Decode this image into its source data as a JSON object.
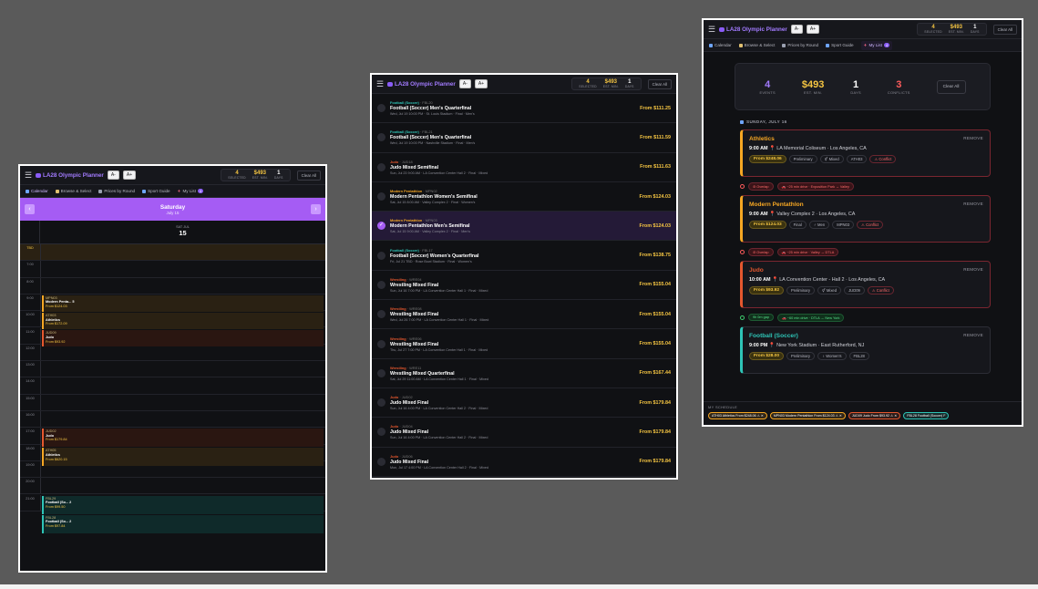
{
  "app": {
    "title": "LA28 Olympic Planner",
    "font_small": "A-",
    "font_large": "A+",
    "stats": {
      "selected_value": "4",
      "selected_label": "SELECTED",
      "min_value": "$493",
      "min_label": "EST. MIN.",
      "days_value": "1",
      "days_label": "DAYS"
    },
    "clear_label": "Clear All",
    "tabs": [
      "Calendar",
      "Browse & Select",
      "Prices by Round",
      "Sport Guide",
      "My List"
    ],
    "my_list_count": "4"
  },
  "calendar": {
    "day_name": "Saturday",
    "day_sub": "July 15",
    "col_dayname": "SAT JUL",
    "col_daynum": "15",
    "hours": [
      "TBD",
      "7:00",
      "8:00",
      "9:00",
      "10:00",
      "11:00",
      "12:00",
      "13:00",
      "14:00",
      "15:00",
      "16:00",
      "17:00",
      "18:00",
      "19:00",
      "20:00",
      "21:00"
    ],
    "events": [
      {
        "code": "MPN03",
        "name": "Modern Penta... 5",
        "price": "From $124.03",
        "color": "#f5a623"
      },
      {
        "code": "ATH03",
        "name": "Athletics",
        "price": "From $172.09",
        "color": "#f5a623"
      },
      {
        "code": "JUD09",
        "name": "Judo",
        "price": "From $93.92",
        "color": "#e4572e"
      },
      {
        "code": "JUD02",
        "name": "Judo",
        "price": "From $179.84",
        "color": "#e4572e"
      },
      {
        "code": "ATH05",
        "name": "Athletics",
        "price": "From $620.15",
        "color": "#f5a623"
      },
      {
        "code": "FBL29",
        "name": "Football (So... 2",
        "price": "From $99.50",
        "color": "#2ec4b6"
      },
      {
        "code": "FBL28",
        "name": "Football (So... 2",
        "price": "From $97.84",
        "color": "#2ec4b6"
      }
    ]
  },
  "browse": {
    "rows": [
      {
        "cat": "Football (Soccer)",
        "code": "FBL20",
        "title": "Football (Soccer) Men's Quarterfinal",
        "meta": "Wed, Jul 19 10:00 PM · St. Louis Stadium · Final · Men's",
        "price": "From $111.25",
        "color": "#2ec4b6",
        "selected": false
      },
      {
        "cat": "Football (Soccer)",
        "code": "FBL21",
        "title": "Football (Soccer) Men's Quarterfinal",
        "meta": "Wed, Jul 19 10:00 PM · Nashville Stadium · Final · Men's",
        "price": "From $111.59",
        "color": "#2ec4b6",
        "selected": false
      },
      {
        "cat": "Judo",
        "code": "JUD18",
        "title": "Judo Mixed Semifinal",
        "meta": "Sun, Jul 23 9:00 AM · LA Convention Center Hall 2 · Final · Mixed",
        "price": "From $111.63",
        "color": "#e4572e",
        "selected": false
      },
      {
        "cat": "Modern Pentathlon",
        "code": "MPN02",
        "title": "Modern Pentathlon Women's Semifinal",
        "meta": "Sat, Jul 15 8:00 AM · Valley Complex 2 · Final · Women's",
        "price": "From $124.03",
        "color": "#f5a623",
        "selected": false
      },
      {
        "cat": "Modern Pentathlon",
        "code": "MPN03",
        "title": "Modern Pentathlon Men's Semifinal",
        "meta": "Sat, Jul 15 9:00 AM · Valley Complex 2 · Final · Men's",
        "price": "From $124.03",
        "color": "#f5a623",
        "selected": true
      },
      {
        "cat": "Football (Soccer)",
        "code": "FBL17",
        "title": "Football (Soccer) Women's Quarterfinal",
        "meta": "Fri, Jul 21 TBD · Rose Bowl Stadium · Final · Women's",
        "price": "From $138.75",
        "color": "#2ec4b6",
        "selected": false,
        "tbd": true
      },
      {
        "cat": "Wrestling",
        "code": "WRE04",
        "title": "Wrestling Mixed Final",
        "meta": "Sun, Jul 16 7:00 PM · LA Convention Center Hall 1 · Final · Mixed",
        "price": "From $155.04",
        "color": "#e4572e",
        "selected": false
      },
      {
        "cat": "Wrestling",
        "code": "WRE08",
        "title": "Wrestling Mixed Final",
        "meta": "Wed, Jul 26 7:00 PM · LA Convention Center Hall 1 · Final · Mixed",
        "price": "From $155.04",
        "color": "#e4572e",
        "selected": false
      },
      {
        "cat": "Wrestling",
        "code": "WRE06",
        "title": "Wrestling Mixed Final",
        "meta": "Thu, Jul 27 7:00 PM · LA Convention Center Hall 1 · Final · Mixed",
        "price": "From $155.04",
        "color": "#e4572e",
        "selected": false
      },
      {
        "cat": "Wrestling",
        "code": "WRE11",
        "title": "Wrestling Mixed Quarterfinal",
        "meta": "Sat, Jul 29 11:00 AM · LA Convention Center Hall 1 · Final · Mixed",
        "price": "From $167.44",
        "color": "#e4572e",
        "selected": false
      },
      {
        "cat": "Judo",
        "code": "JUD02",
        "title": "Judo Mixed Final",
        "meta": "Sun, Jul 16 4:00 PM · LA Convention Center Hall 2 · Final · Mixed",
        "price": "From $179.84",
        "color": "#e4572e",
        "selected": false
      },
      {
        "cat": "Judo",
        "code": "JUD04",
        "title": "Judo Mixed Final",
        "meta": "Sun, Jul 16 4:00 PM · LA Convention Center Hall 2 · Final · Mixed",
        "price": "From $179.84",
        "color": "#e4572e",
        "selected": false
      },
      {
        "cat": "Judo",
        "code": "JUD06",
        "title": "Judo Mixed Final",
        "meta": "Mon, Jul 17 4:00 PM · LA Convention Center Hall 2 · Final · Mixed",
        "price": "From $179.84",
        "color": "#e4572e",
        "selected": false
      }
    ]
  },
  "mylist": {
    "summary": [
      {
        "value": "4",
        "label": "EVENTS",
        "color": "#a27bff"
      },
      {
        "value": "$493",
        "label": "EST. MIN.",
        "color": "#f5c542"
      },
      {
        "value": "1",
        "label": "DAYS",
        "color": "#ffffff"
      },
      {
        "value": "3",
        "label": "CONFLICTS",
        "color": "#ff5c5c"
      }
    ],
    "clear_label": "Clear All",
    "day_header": "SUNDAY, JULY 16",
    "remove_label": "REMOVE",
    "cards": [
      {
        "sport": "Athletics",
        "time": "9:00 AM",
        "venue": "LA Memorial Coliseum · Los Angeles, CA",
        "price": "From $248.06",
        "tags": [
          "Preliminary",
          "⚥ Mixed",
          "ATH03"
        ],
        "conflict": "⚠ Conflict",
        "color": "#f5a623"
      },
      {
        "sport": "Modern Pentathlon",
        "time": "9:00 AM",
        "venue": "Valley Complex 2 · Los Angeles, CA",
        "price": "From $124.03",
        "tags": [
          "Final",
          "♂ Men",
          "MPN03"
        ],
        "conflict": "⚠ Conflict",
        "color": "#f5a623"
      },
      {
        "sport": "Judo",
        "time": "10:00 AM",
        "venue": "LA Convention Center - Hall 2 · Los Angeles, CA",
        "price": "From $93.92",
        "tags": [
          "Preliminary",
          "⚥ Mixed",
          "JUD09"
        ],
        "conflict": "⚠ Conflict",
        "color": "#e4572e"
      },
      {
        "sport": "Football (Soccer)",
        "time": "9:00 PM",
        "venue": "New York Stadium · East Rutherford, NJ",
        "price": "From $28.00",
        "tags": [
          "Preliminary",
          "♀ Women's",
          "FBL28"
        ],
        "conflict": "",
        "color": "#2ec4b6"
      }
    ],
    "gaps": [
      {
        "a": "⊘ Overlap",
        "b": "🚗 ~25 min drive · Exposition Park → Valley",
        "ok": false
      },
      {
        "a": "⊘ Overlap",
        "b": "🚗 ~25 min drive · Valley → DTLA",
        "ok": false
      },
      {
        "a": "9h 0m gap",
        "b": "🚗 ~60 min drive · DTLA → New York",
        "ok": true
      }
    ],
    "schedule_label": "MY SCHEDULE",
    "pills": [
      {
        "text": "ATH03 Athletics From $248.06 ⚠ ✕",
        "color": "#f5a623"
      },
      {
        "text": "MPN03 Modern Pentathlon From $124.03 ⚠ ✕",
        "color": "#f5a623"
      },
      {
        "text": "JUD09 Judo From $93.92 ⚠ ✕",
        "color": "#e4572e"
      },
      {
        "text": "FBL28 Football (Soccer) F",
        "color": "#2ec4b6"
      }
    ]
  }
}
